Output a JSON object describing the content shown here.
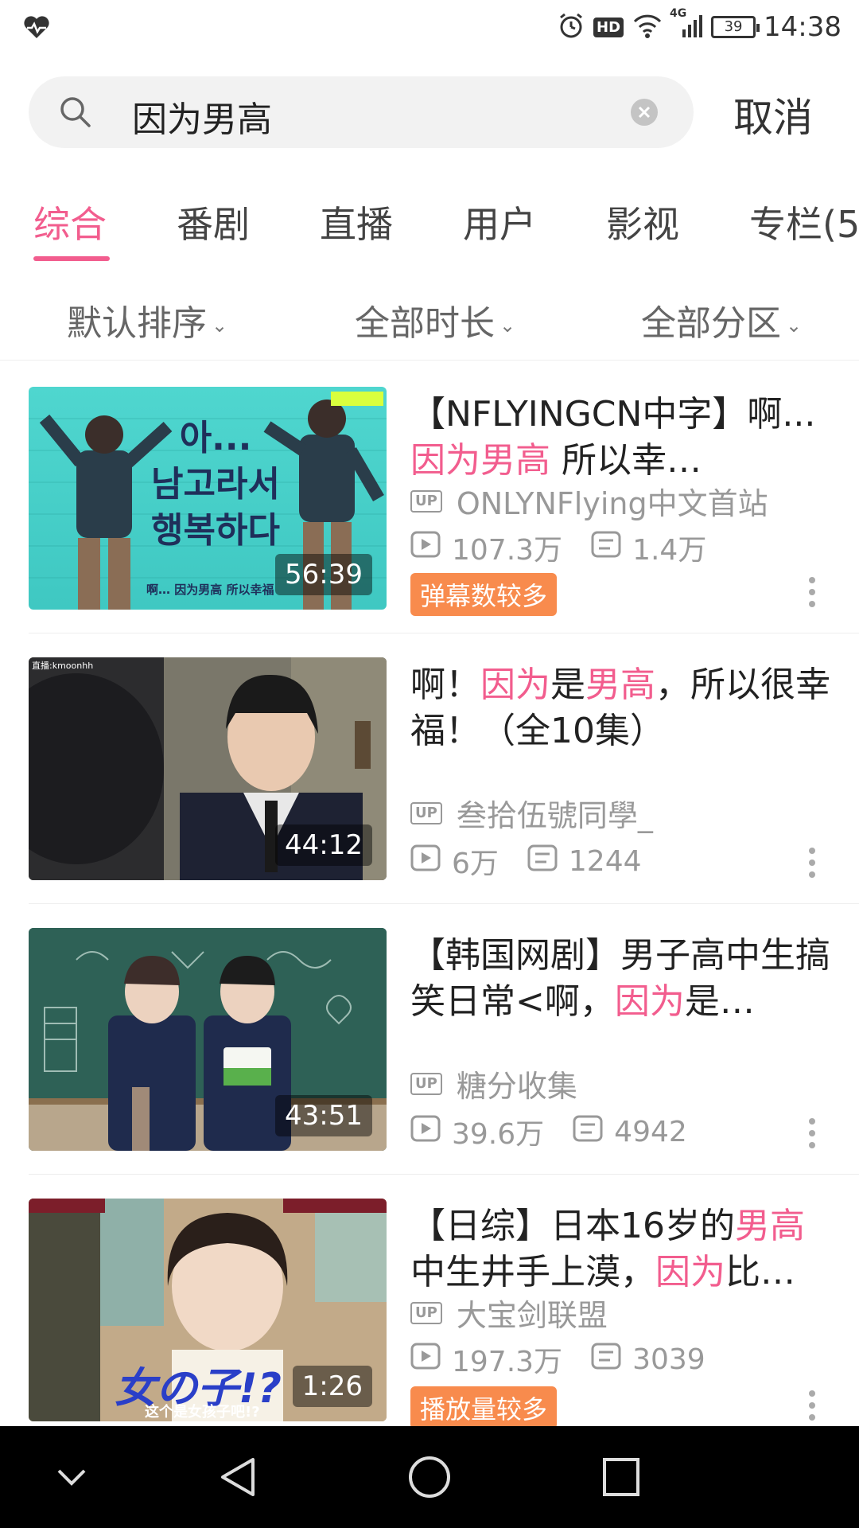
{
  "status_bar": {
    "time": "14:38",
    "network": "4G",
    "hd_label": "HD",
    "battery": "39"
  },
  "search": {
    "query": "因为男高",
    "cancel_label": "取消"
  },
  "tabs": [
    {
      "label": "综合",
      "active": true
    },
    {
      "label": "番剧",
      "active": false
    },
    {
      "label": "直播",
      "active": false
    },
    {
      "label": "用户",
      "active": false
    },
    {
      "label": "影视",
      "active": false
    },
    {
      "label": "专栏(5",
      "active": false
    }
  ],
  "filters": [
    {
      "label": "默认排序"
    },
    {
      "label": "全部时长"
    },
    {
      "label": "全部分区"
    }
  ],
  "videos": [
    {
      "title_parts": [
        [
          "【NFLYINGCN中字】啊...",
          false
        ],
        [
          "因为男高",
          true
        ],
        [
          " 所以幸…",
          false
        ]
      ],
      "duration": "56:39",
      "uploader": "ONLYNFlying中文首站",
      "views": "107.3万",
      "danmaku": "1.4万",
      "tag": "弹幕数较多",
      "thumb_text": "아...\n남고라서\n행복하다",
      "thumb_caption": "啊… 因为男高 所以幸福"
    },
    {
      "title_parts": [
        [
          "啊！",
          false
        ],
        [
          "因为",
          true
        ],
        [
          "是",
          false
        ],
        [
          "男高",
          true
        ],
        [
          "，所以很幸福！（全10集）",
          false
        ]
      ],
      "duration": "44:12",
      "uploader": "叁拾伍號同學_",
      "views": "6万",
      "danmaku": "1244",
      "tag": "",
      "thumb_corner": "直播:kmoonhh"
    },
    {
      "title_parts": [
        [
          "【韩国网剧】男子高中生搞笑日常<啊，",
          false
        ],
        [
          "因为",
          true
        ],
        [
          "是…",
          false
        ]
      ],
      "duration": "43:51",
      "uploader": "糖分收集",
      "views": "39.6万",
      "danmaku": "4942",
      "tag": ""
    },
    {
      "title_parts": [
        [
          "【日综】日本16岁的",
          false
        ],
        [
          "男高",
          true
        ],
        [
          "中生井手上漠，",
          false
        ],
        [
          "因为",
          true
        ],
        [
          "比…",
          false
        ]
      ],
      "duration": "1:26",
      "uploader": "大宝剑联盟",
      "views": "197.3万",
      "danmaku": "3039",
      "tag": "播放量较多",
      "thumb_text": "女の子!?",
      "thumb_caption": "这个是女孩子吧!?"
    }
  ],
  "labels": {
    "up_badge": "UP"
  }
}
